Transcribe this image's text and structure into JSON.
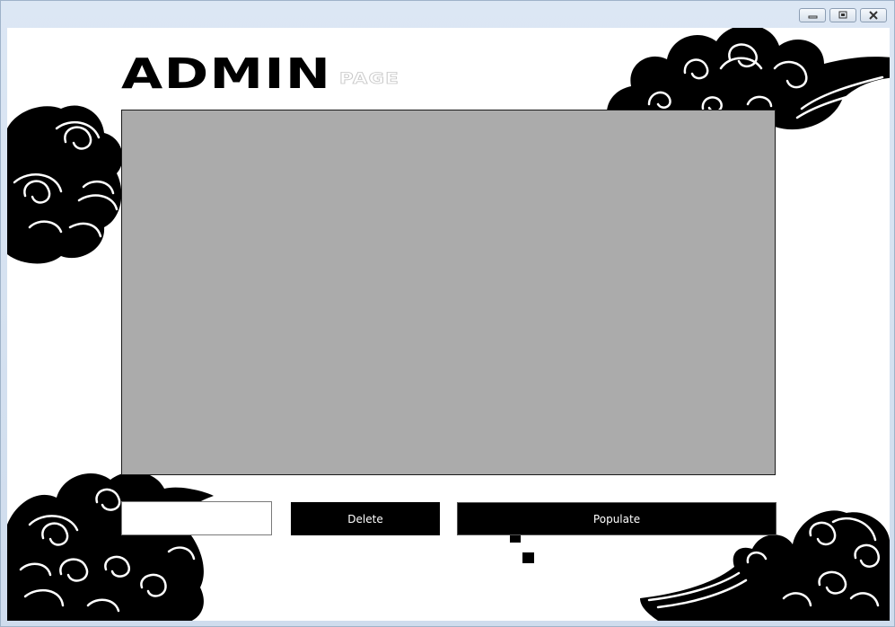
{
  "window": {
    "controls": {
      "minimize_icon": "minimize-icon",
      "maximize_icon": "restore-icon",
      "close_icon": "close-icon"
    }
  },
  "header": {
    "title_main": "ADMIN",
    "title_sub": "PAGE"
  },
  "form": {
    "id_input_value": "",
    "id_input_placeholder": ""
  },
  "actions": {
    "delete_label": "Delete",
    "populate_label": "Populate"
  },
  "colors": {
    "grid_background": "#ababab",
    "button_background": "#000000",
    "button_text": "#ffffff",
    "decoration": "#000000"
  }
}
